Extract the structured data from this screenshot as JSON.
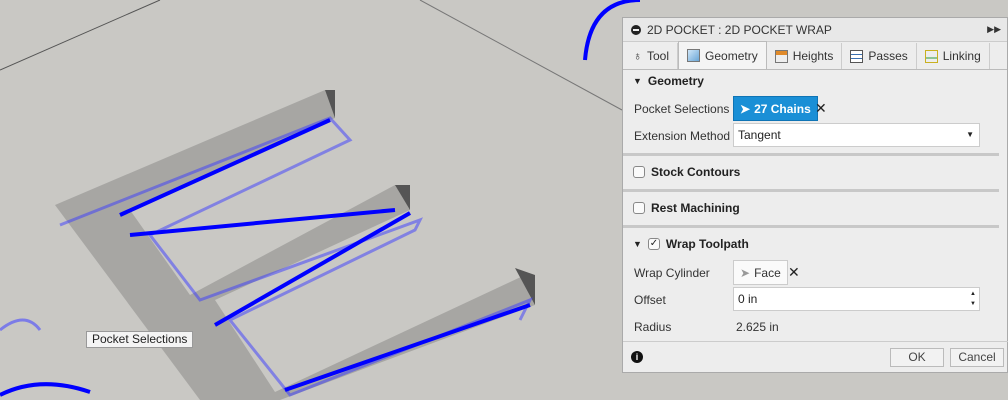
{
  "panel": {
    "title": "2D POCKET : 2D POCKET WRAP",
    "tabs": [
      {
        "label": "Tool"
      },
      {
        "label": "Geometry"
      },
      {
        "label": "Heights"
      },
      {
        "label": "Passes"
      },
      {
        "label": "Linking"
      }
    ],
    "geometry": {
      "header": "Geometry",
      "pocket_label": "Pocket Selections",
      "pocket_value": "27 Chains",
      "extension_label": "Extension Method",
      "extension_value": "Tangent"
    },
    "stock_contours": "Stock Contours",
    "rest_machining": "Rest Machining",
    "wrap": {
      "header": "Wrap Toolpath",
      "checked": true,
      "cylinder_label": "Wrap Cylinder",
      "cylinder_value": "Face",
      "offset_label": "Offset",
      "offset_value": "0 in",
      "radius_label": "Radius",
      "radius_value": "2.625 in"
    },
    "ok": "OK",
    "cancel": "Cancel"
  },
  "tooltip": "Pocket Selections",
  "colors": {
    "accent": "#1a8fd6",
    "toolpath": "#1010ff"
  }
}
